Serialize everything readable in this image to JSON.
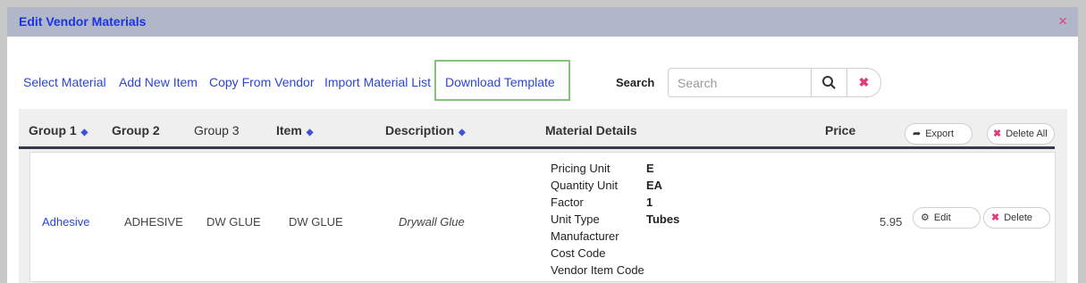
{
  "dialog": {
    "title": "Edit Vendor Materials",
    "close_glyph": "×"
  },
  "toolbar": {
    "links": [
      "Select Material",
      "Add New Item",
      "Copy From Vendor",
      "Import Material List",
      "Download Template"
    ],
    "search_label": "Search",
    "search_placeholder": "Search",
    "search_icon": "search-icon",
    "clear_icon": "close-icon"
  },
  "table": {
    "headers": {
      "group1": "Group 1",
      "group2": "Group 2",
      "group3": "Group 3",
      "item": "Item",
      "description": "Description",
      "material_details": "Material Details",
      "price": "Price"
    },
    "sortable": [
      "group1",
      "item",
      "description"
    ],
    "export_label": "Export",
    "delete_all_label": "Delete All",
    "rows": [
      {
        "group1": "Adhesive",
        "group2": "ADHESIVE",
        "group3": "DW GLUE",
        "item": "DW GLUE",
        "description": "Drywall Glue",
        "details": [
          {
            "label": "Pricing Unit",
            "value": "E"
          },
          {
            "label": "Quantity Unit",
            "value": "EA"
          },
          {
            "label": "Factor",
            "value": "1"
          },
          {
            "label": "Unit Type",
            "value": "Tubes"
          },
          {
            "label": "Manufacturer",
            "value": ""
          },
          {
            "label": "Cost Code",
            "value": ""
          },
          {
            "label": "Vendor Item Code",
            "value": ""
          }
        ],
        "price": "5.95",
        "edit_label": "Edit",
        "delete_label": "Delete"
      }
    ]
  },
  "colors": {
    "titlebar_bg": "#b0b7c8",
    "title_text": "#1a33e6",
    "link": "#2a45d6",
    "accent_pink": "#e23d7a",
    "highlight_green": "#84c47a",
    "header_rule": "#343a4a"
  }
}
